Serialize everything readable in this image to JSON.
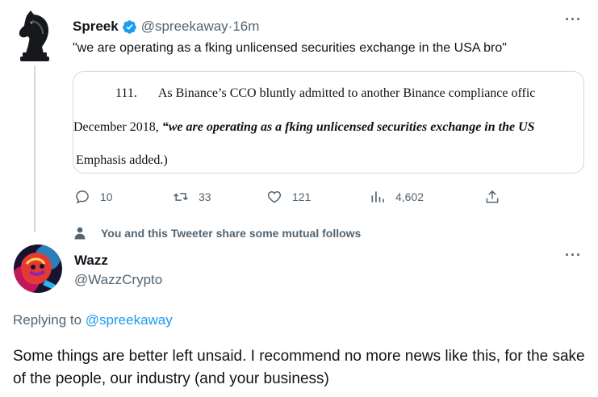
{
  "tweet": {
    "author_name": "Spreek",
    "author_handle": "@spreekaway",
    "separator": " · ",
    "time": "16m",
    "more": "···",
    "text": "\"we are operating as a fking unlicensed securities exchange in the USA bro\"",
    "document": {
      "line1_number": "111.",
      "line1_text": "As Binance’s CCO bluntly admitted to another Binance compliance offic",
      "line2_prefix": "December 2018, ",
      "line2_emphasis": "“we are operating as a fking unlicensed securities exchange in the US",
      "line3": "Emphasis added.)"
    },
    "actions": {
      "replies": "10",
      "retweets": "33",
      "likes": "121",
      "views": "4,602"
    },
    "colors": {
      "verified": "#1d9bf0",
      "muted": "#536471",
      "thread_line": "#cfd9de"
    }
  },
  "social_context": "You and this Tweeter share some mutual follows",
  "reply": {
    "author_name": "Wazz",
    "author_handle": "@WazzCrypto",
    "more": "···",
    "replying_to_label": "Replying to ",
    "replying_to_handle": "@spreekaway",
    "text": "Some things are better left unsaid. I recommend no more news like this, for the sake of the people, our industry (and your business)"
  }
}
